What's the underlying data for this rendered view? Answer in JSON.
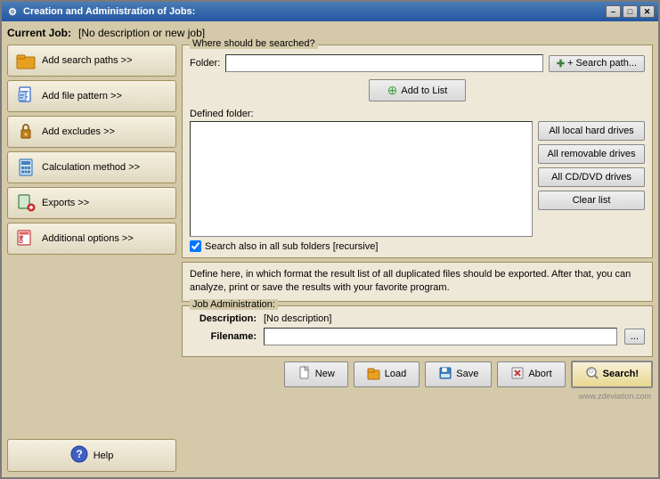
{
  "window": {
    "title": "Creation and Administration of Jobs:",
    "min_label": "–",
    "max_label": "□",
    "close_label": "✕"
  },
  "current_job": {
    "label": "Current Job:",
    "value": "[No description or new job]"
  },
  "sidebar": {
    "buttons": [
      {
        "id": "add-search-paths",
        "label": "Add search paths >>",
        "icon": "folder"
      },
      {
        "id": "add-file-pattern",
        "label": "Add file pattern >>",
        "icon": "file"
      },
      {
        "id": "add-excludes",
        "label": "Add excludes >>",
        "icon": "lock"
      },
      {
        "id": "calculation-method",
        "label": "Calculation method >>",
        "icon": "calc"
      },
      {
        "id": "exports",
        "label": "Exports >>",
        "icon": "export"
      },
      {
        "id": "additional-options",
        "label": "Additional options >>",
        "icon": "options"
      }
    ],
    "help_label": "Help"
  },
  "search_group": {
    "title": "Where should be searched?",
    "folder_label": "Folder:",
    "folder_value": "",
    "folder_placeholder": "",
    "search_path_btn": "+ Search path...",
    "add_to_list_btn": "Add to List",
    "defined_folder_label": "Defined folder:",
    "drive_buttons": [
      "All local hard drives",
      "All removable drives",
      "All CD/DVD drives",
      "Clear list"
    ]
  },
  "checkbox": {
    "label": "Search also in all sub folders [recursive]",
    "checked": true
  },
  "info_text": "Define here, in which format the result list of all duplicated files should be exported. After that, you can analyze, print or save the results with your favorite program.",
  "job_admin": {
    "title": "Job Administration:",
    "desc_label": "Description:",
    "desc_value": "[No description]",
    "filename_label": "Filename:",
    "filename_value": "",
    "browse_label": "..."
  },
  "toolbar": {
    "new_label": "New",
    "load_label": "Load",
    "save_label": "Save",
    "abort_label": "Abort",
    "search_label": "Search!"
  },
  "watermark": "www.zdeviation.com"
}
